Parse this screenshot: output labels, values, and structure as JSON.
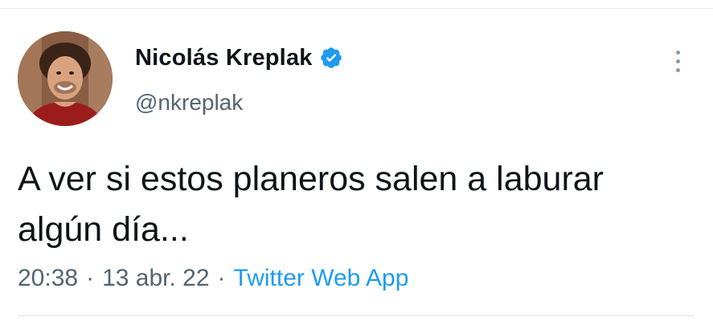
{
  "tweet": {
    "author": {
      "display_name": "Nicolás Kreplak",
      "handle": "@nkreplak",
      "verified": true,
      "verified_icon": "verified-badge-icon",
      "avatar": "profile-photo"
    },
    "text_line1": "A ver si estos planeros salen a laburar",
    "text_line2": "algún día...",
    "time": "20:38",
    "date": "13 abr. 22",
    "separator": "·",
    "source": "Twitter Web App",
    "more_icon": "more-vertical-icon"
  },
  "colors": {
    "text": "#0f1419",
    "secondary": "#536471",
    "link": "#1d9bf0",
    "verified": "#1d9bf0"
  }
}
